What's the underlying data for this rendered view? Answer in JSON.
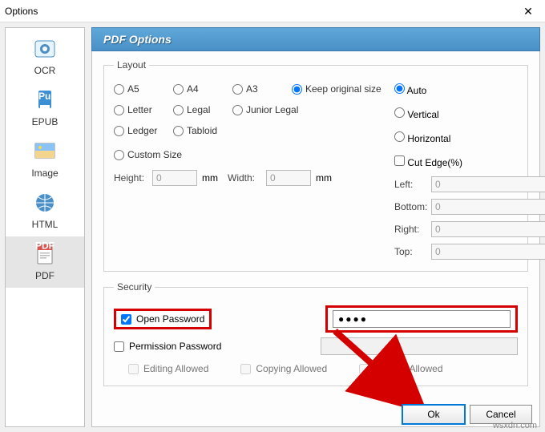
{
  "window": {
    "title": "Options"
  },
  "sidebar": {
    "items": [
      {
        "label": "OCR"
      },
      {
        "label": "EPUB"
      },
      {
        "label": "Image"
      },
      {
        "label": "HTML"
      },
      {
        "label": "PDF"
      }
    ]
  },
  "header": {
    "title": "PDF Options"
  },
  "layout": {
    "legend": "Layout",
    "sizes": {
      "a5": "A5",
      "a4": "A4",
      "a3": "A3",
      "keep": "Keep original size"
    },
    "sizes2": {
      "letter": "Letter",
      "legal": "Legal",
      "junior": "Junior Legal"
    },
    "sizes3": {
      "ledger": "Ledger",
      "tabloid": "Tabloid"
    },
    "custom": "Custom Size",
    "height_label": "Height:",
    "height_value": "0",
    "mm": "mm",
    "width_label": "Width:",
    "width_value": "0",
    "orient": {
      "auto": "Auto",
      "vertical": "Vertical",
      "horizontal": "Horizontal"
    },
    "cutedge": "Cut Edge(%)",
    "edges": {
      "left_label": "Left:",
      "left_value": "0",
      "bottom_label": "Bottom:",
      "bottom_value": "0",
      "right_label": "Right:",
      "right_value": "0",
      "top_label": "Top:",
      "top_value": "0"
    }
  },
  "security": {
    "legend": "Security",
    "open_pw": "Open Password",
    "open_pw_value": "●●●●",
    "perm_pw": "Permission Password",
    "perm_pw_value": "",
    "editing": "Editing Allowed",
    "copying": "Copying Allowed",
    "printing": "Printing Allowed"
  },
  "buttons": {
    "ok": "Ok",
    "cancel": "Cancel"
  },
  "watermark": "wsxdn.com",
  "colors": {
    "accent": "#0078d7",
    "highlight": "#d40000"
  }
}
